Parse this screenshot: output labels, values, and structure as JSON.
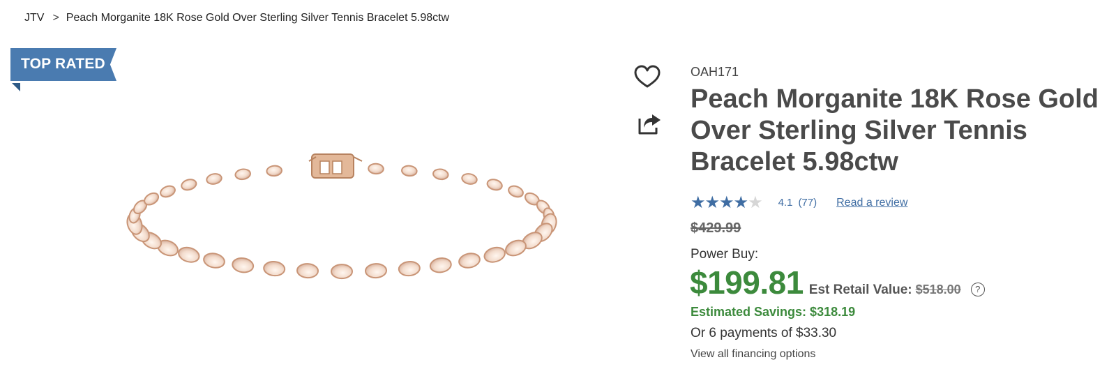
{
  "breadcrumb": {
    "home": "JTV",
    "separator": ">",
    "current": "Peach Morganite 18K Rose Gold Over Sterling Silver Tennis Bracelet 5.98ctw"
  },
  "badge": {
    "label": "TOP RATED",
    "color": "#4a7bb0"
  },
  "actions": {
    "favorite_icon": "heart-icon",
    "share_icon": "share-icon"
  },
  "product": {
    "sku": "OAH171",
    "title": "Peach Morganite 18K Rose Gold Over Sterling Silver Tennis Bracelet 5.98ctw",
    "image": "rose-gold-tennis-bracelet"
  },
  "rating": {
    "stars": 4.1,
    "max_stars": 5,
    "value": "4.1",
    "count": "(77)",
    "review_link": "Read a review",
    "color": "#3f6da3"
  },
  "pricing": {
    "original_price": "$429.99",
    "power_buy_label": "Power Buy:",
    "price": "$199.81",
    "est_retail_label": "Est Retail Value:",
    "est_retail_value": "$518.00",
    "help_icon": "question-circle-icon",
    "savings": "Estimated Savings: $318.19",
    "payments": "Or 6 payments of $33.30",
    "financing_link": "View all financing options",
    "accent_color": "#3c8a3c"
  }
}
